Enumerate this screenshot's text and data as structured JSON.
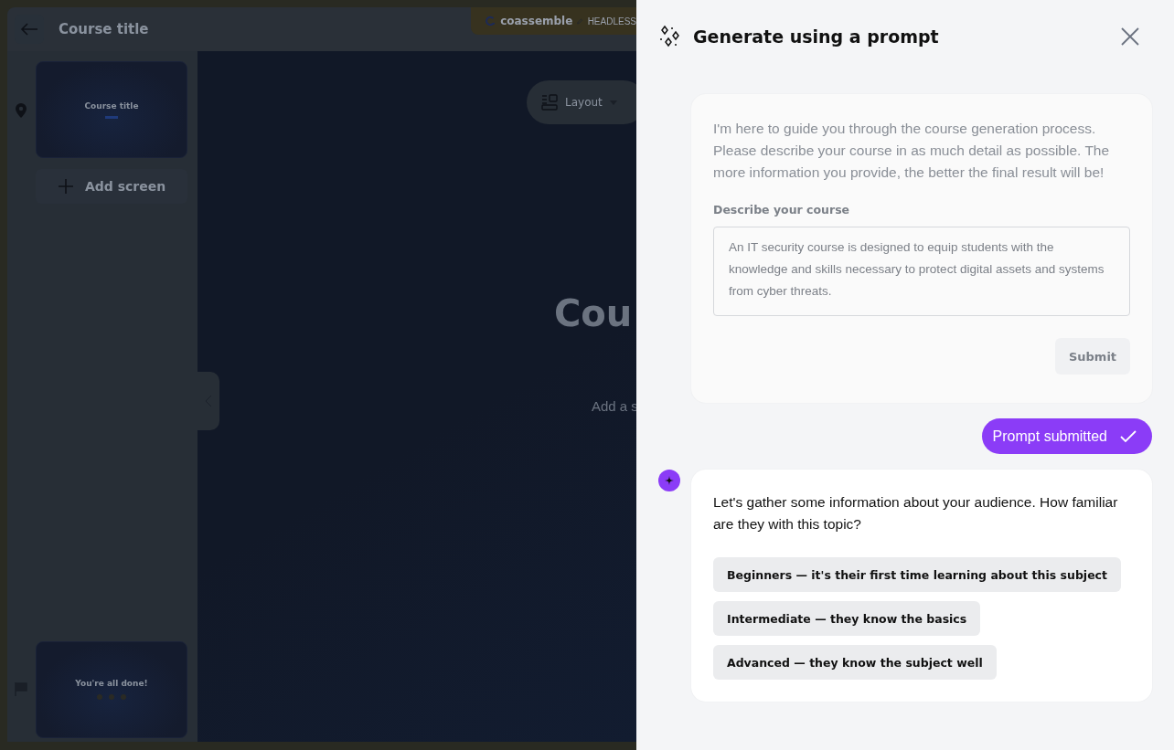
{
  "editor": {
    "course_title": "Course title",
    "brand": {
      "name": "coassemble",
      "tag": "HEADLESS"
    },
    "screens": [
      {
        "title": "Course title",
        "kind": "start"
      },
      {
        "title": "You're all done!",
        "kind": "end"
      }
    ],
    "add_screen": "Add screen",
    "canvas": {
      "layout_button": "Layout",
      "heading": "Cou",
      "subtitle": "Add a s"
    }
  },
  "panel": {
    "title": "Generate using a prompt",
    "intro": "I'm here to guide you through the course generation process. Please describe your course in as much detail as possible. The more information you provide, the better the final result will be!",
    "field_label": "Describe your course",
    "field_value": "An IT security course is designed to equip students with the knowledge and skills necessary to protect digital assets and systems from cyber threats.",
    "submit": {
      "label": "Submit",
      "disabled": true
    },
    "submitted": "Prompt submitted",
    "question": "Let's gather some information about your audience. How familiar are they with this topic?",
    "options": [
      {
        "label": "Beginners — it's their first time learning about this subject"
      },
      {
        "label": "Intermediate — they know the basics"
      },
      {
        "label": "Advanced — they know the subject well"
      }
    ]
  }
}
